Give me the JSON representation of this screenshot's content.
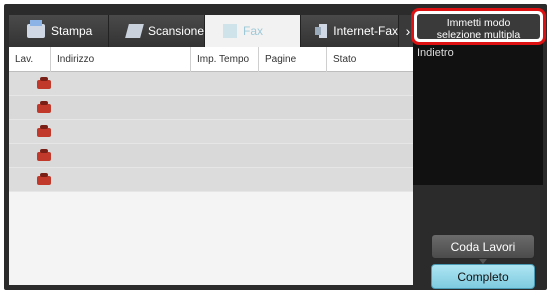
{
  "tabs": [
    {
      "label": "Stampa",
      "icon": "printer-icon"
    },
    {
      "label": "Scansione",
      "icon": "scanner-icon"
    },
    {
      "label": "Fax",
      "icon": "fax-icon",
      "active": true
    },
    {
      "label": "Internet-Fax",
      "icon": "internet-fax-icon"
    }
  ],
  "tab_more": "›",
  "menu_button": {
    "line1": "Immetti modo",
    "line2": "selezione multipla"
  },
  "back_label": "Indietro",
  "columns": [
    "Lav.",
    "Indirizzo",
    "Imp. Tempo",
    "Pagine",
    "Stato"
  ],
  "rows": [
    {
      "address": "",
      "time": "",
      "pages": "",
      "status": ""
    },
    {
      "address": "",
      "time": "",
      "pages": "",
      "status": ""
    },
    {
      "address": "",
      "time": "",
      "pages": "",
      "status": ""
    },
    {
      "address": "",
      "time": "",
      "pages": "",
      "status": ""
    },
    {
      "address": "",
      "time": "",
      "pages": "",
      "status": ""
    }
  ],
  "buttons": {
    "queue": "Coda Lavori",
    "done": "Completo"
  },
  "colors": {
    "accent_red": "#d11111",
    "active_tab_text": "#9ec9d8",
    "done_button": "#7fcbe0"
  }
}
